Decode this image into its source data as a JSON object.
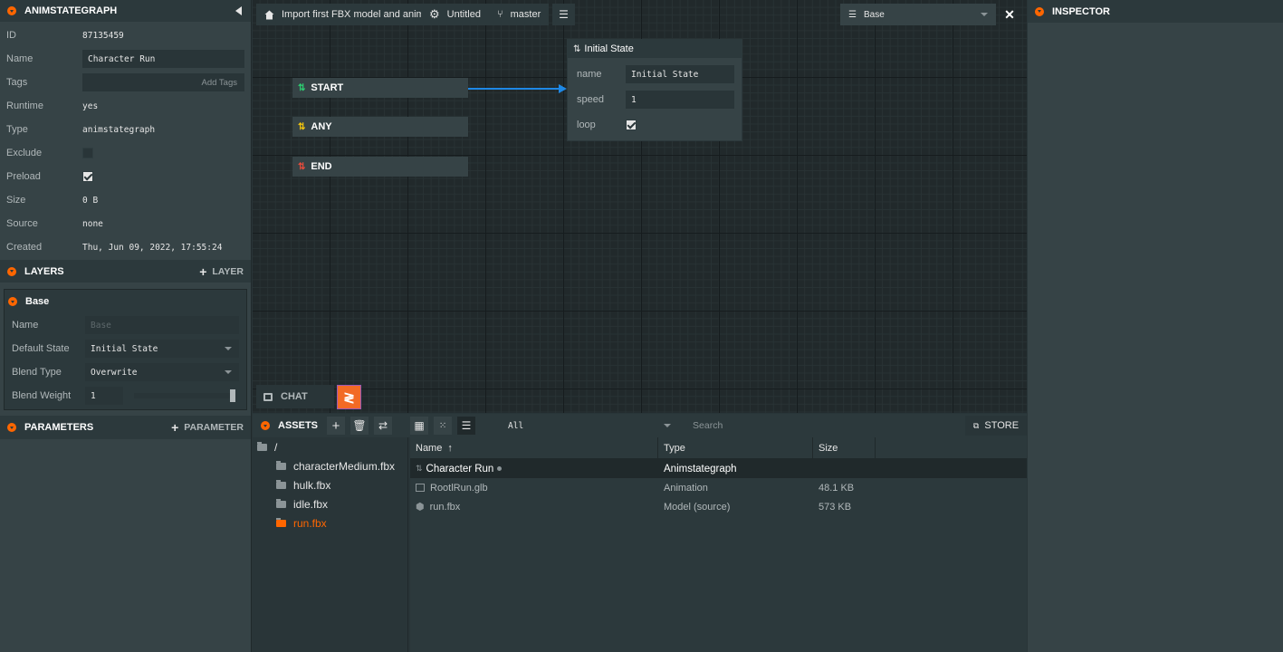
{
  "left_panel": {
    "title": "ANIMSTATEGRAPH",
    "rows": [
      {
        "label": "ID",
        "value": "87135459"
      },
      {
        "label": "Name",
        "value": "Character Run"
      },
      {
        "label": "Tags",
        "value": "Add Tags"
      },
      {
        "label": "Runtime",
        "value": "yes"
      },
      {
        "label": "Type",
        "value": "animstategraph"
      },
      {
        "label": "Exclude",
        "value": ""
      },
      {
        "label": "Preload",
        "value": ""
      },
      {
        "label": "Size",
        "value": "0 B"
      },
      {
        "label": "Source",
        "value": "none"
      },
      {
        "label": "Created",
        "value": "Thu, Jun 09, 2022, 17:55:24"
      }
    ],
    "layers": {
      "title": "LAYERS",
      "add_label": "LAYER",
      "base": {
        "title": "Base",
        "name_label": "Name",
        "name_placeholder": "Base",
        "default_state_label": "Default State",
        "default_state_value": "Initial State",
        "blend_type_label": "Blend Type",
        "blend_type_value": "Overwrite",
        "blend_weight_label": "Blend Weight",
        "blend_weight_value": "1"
      }
    },
    "parameters": {
      "title": "PARAMETERS",
      "add_label": "PARAMETER"
    }
  },
  "toolbar": {
    "project": "Import first FBX model and anim",
    "scene": "Untitled",
    "branch": "master",
    "layer_select": "Base"
  },
  "graph": {
    "nodes": [
      {
        "label": "START",
        "icon": "start-icon",
        "color": "#2ecc71"
      },
      {
        "label": "ANY",
        "icon": "any-icon",
        "color": "#f1c40f"
      },
      {
        "label": "END",
        "icon": "end-icon",
        "color": "#e74c3c"
      }
    ],
    "initial_state": {
      "title": "Initial State",
      "name_label": "name",
      "name_value": "Initial State",
      "speed_label": "speed",
      "speed_value": "1",
      "loop_label": "loop"
    },
    "transition_color": "#1e88e5"
  },
  "chat": {
    "label": "CHAT"
  },
  "assets": {
    "title": "ASSETS",
    "filter_value": "All",
    "search_placeholder": "Search",
    "store_label": "STORE",
    "tree": {
      "root": "/",
      "folders": [
        "characterMedium.fbx",
        "hulk.fbx",
        "idle.fbx",
        "run.fbx"
      ],
      "active": "run.fbx"
    },
    "columns": [
      "Name",
      "Type",
      "Size"
    ],
    "rows": [
      {
        "name": "Character Run",
        "type": "Animstategraph",
        "size": "",
        "icon": "animstategraph-icon"
      },
      {
        "name": "RootlRun.glb",
        "type": "Animation",
        "size": "48.1 KB",
        "icon": "animation-icon"
      },
      {
        "name": "run.fbx",
        "type": "Model (source)",
        "size": "573 KB",
        "icon": "model-icon"
      }
    ]
  },
  "inspector": {
    "title": "INSPECTOR"
  },
  "colors": {
    "accent": "#ff6600",
    "panel": "#364346",
    "graph_bg": "#21292b"
  }
}
